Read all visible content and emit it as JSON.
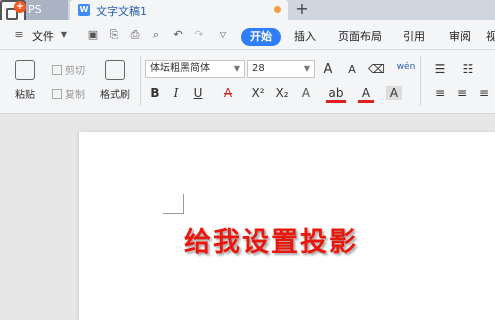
{
  "tabs": {
    "inactive_label": "PS",
    "active_label": "文字文稿1",
    "new_tab": "+"
  },
  "menu": {
    "file_label": "文件",
    "items": [
      "开始",
      "插入",
      "页面布局",
      "引用",
      "审阅",
      "视"
    ]
  },
  "ribbon": {
    "paste": "粘贴",
    "cut": "剪切",
    "copy": "复制",
    "format_painter": "格式刷",
    "font_name": "体坛粗黑简体",
    "font_size": "28",
    "grow_font": "A",
    "shrink_font": "A",
    "bold": "B",
    "italic": "I",
    "underline": "U",
    "strikethrough": "A",
    "superscript": "X²",
    "subscript": "X₂",
    "text_effect": "A",
    "highlight": "ab",
    "font_color": "A",
    "char_shading": "A",
    "phonetic": "wén"
  },
  "document": {
    "text": "给我设置投影"
  },
  "colors": {
    "accent": "#2f7ef7",
    "doc_text": "#e8180c",
    "unsaved": "#f59b42"
  }
}
